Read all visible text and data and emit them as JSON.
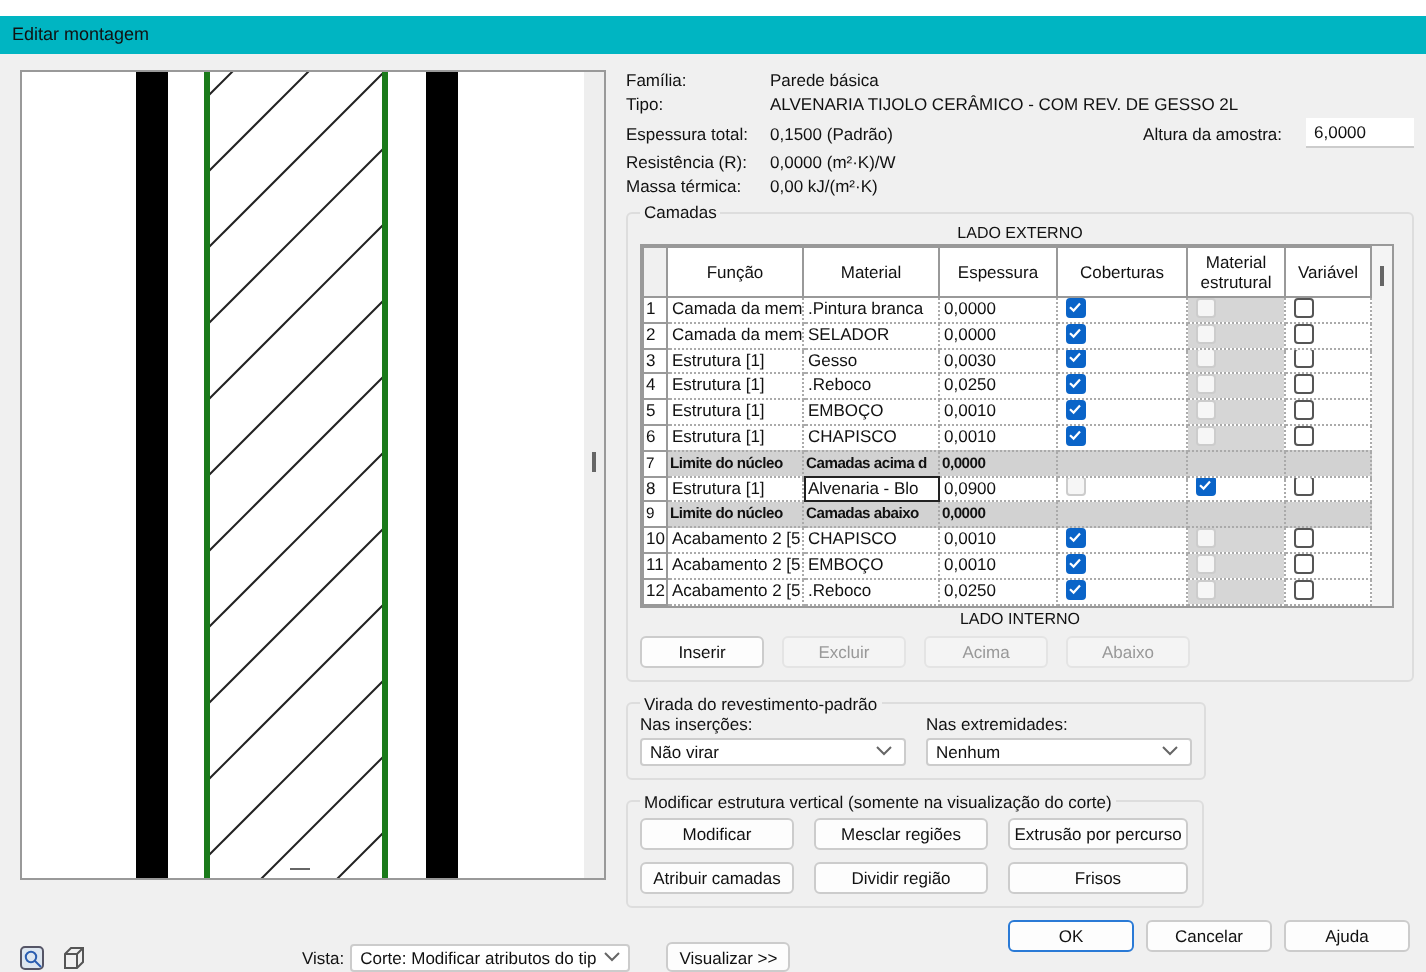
{
  "window": {
    "title": "Editar montagem"
  },
  "properties": [
    {
      "label": "Família:",
      "value": "Parede básica"
    },
    {
      "label": "Tipo:",
      "value": "ALVENARIA TIJOLO CERÂMICO - COM REV. DE GESSO 2L"
    },
    {
      "label": "Espessura total:",
      "value": "0,1500 (Padrão)"
    },
    {
      "label": "Resistência (R):",
      "value": "0,0000 (m²·K)/W"
    },
    {
      "label": "Massa térmica:",
      "value": "0,00 kJ/(m²·K)"
    }
  ],
  "sample_height": {
    "label": "Altura da amostra:",
    "value": "6,0000"
  },
  "layers": {
    "title": "Camadas",
    "top_label": "LADO EXTERNO",
    "bottom_label": "LADO INTERNO",
    "columns": [
      "Função",
      "Material",
      "Espessura",
      "Coberturas",
      "Material estrutural",
      "Variável"
    ],
    "rows": [
      {
        "index": "1",
        "kind": "layer",
        "function": "Camada da mem",
        "material": ".Pintura branca",
        "thickness": "0,0000",
        "focused": false,
        "coverings": {
          "checked": true,
          "disabled": false
        },
        "structural": {
          "checked": false,
          "disabled": true
        },
        "variable": {
          "checked": false
        }
      },
      {
        "index": "2",
        "kind": "layer",
        "function": "Camada da mem",
        "material": "SELADOR",
        "thickness": "0,0000",
        "focused": false,
        "coverings": {
          "checked": true,
          "disabled": false
        },
        "structural": {
          "checked": false,
          "disabled": true
        },
        "variable": {
          "checked": false
        }
      },
      {
        "index": "3",
        "kind": "layer",
        "function": "Estrutura [1]",
        "material": "Gesso",
        "thickness": "0,0030",
        "focused": false,
        "coverings": {
          "checked": true,
          "disabled": false
        },
        "structural": {
          "checked": false,
          "disabled": true
        },
        "variable": {
          "checked": false
        }
      },
      {
        "index": "4",
        "kind": "layer",
        "function": "Estrutura [1]",
        "material": ".Reboco",
        "thickness": "0,0250",
        "focused": false,
        "coverings": {
          "checked": true,
          "disabled": false
        },
        "structural": {
          "checked": false,
          "disabled": true
        },
        "variable": {
          "checked": false
        }
      },
      {
        "index": "5",
        "kind": "layer",
        "function": "Estrutura [1]",
        "material": "EMBOÇO",
        "thickness": "0,0010",
        "focused": false,
        "coverings": {
          "checked": true,
          "disabled": false
        },
        "structural": {
          "checked": false,
          "disabled": true
        },
        "variable": {
          "checked": false
        }
      },
      {
        "index": "6",
        "kind": "layer",
        "function": "Estrutura [1]",
        "material": "CHAPISCO",
        "thickness": "0,0010",
        "focused": false,
        "coverings": {
          "checked": true,
          "disabled": false
        },
        "structural": {
          "checked": false,
          "disabled": true
        },
        "variable": {
          "checked": false
        }
      },
      {
        "index": "7",
        "kind": "boundary",
        "function": "Limite do núcleo",
        "material": "Camadas acima d",
        "thickness": "0,0000"
      },
      {
        "index": "8",
        "kind": "layer",
        "function": "Estrutura [1]",
        "material": "Alvenaria - Blo",
        "thickness": "0,0900",
        "focused": true,
        "coverings": {
          "checked": false,
          "disabled": true
        },
        "structural": {
          "checked": true,
          "disabled": false
        },
        "variable": {
          "checked": false
        }
      },
      {
        "index": "9",
        "kind": "boundary",
        "function": "Limite do núcleo",
        "material": "Camadas abaixo",
        "thickness": "0,0000"
      },
      {
        "index": "10",
        "kind": "layer",
        "function": "Acabamento 2 [5",
        "material": "CHAPISCO",
        "thickness": "0,0010",
        "focused": false,
        "coverings": {
          "checked": true,
          "disabled": false
        },
        "structural": {
          "checked": false,
          "disabled": true
        },
        "variable": {
          "checked": false
        }
      },
      {
        "index": "11",
        "kind": "layer",
        "function": "Acabamento 2 [5",
        "material": "EMBOÇO",
        "thickness": "0,0010",
        "focused": false,
        "coverings": {
          "checked": true,
          "disabled": false
        },
        "structural": {
          "checked": false,
          "disabled": true
        },
        "variable": {
          "checked": false
        }
      },
      {
        "index": "12",
        "kind": "layer",
        "function": "Acabamento 2 [5",
        "material": ".Reboco",
        "thickness": "0,0250",
        "focused": false,
        "coverings": {
          "checked": true,
          "disabled": false
        },
        "structural": {
          "checked": false,
          "disabled": true
        },
        "variable": {
          "checked": false
        }
      }
    ],
    "buttons": [
      {
        "label": "Inserir",
        "disabled": false
      },
      {
        "label": "Excluir",
        "disabled": true
      },
      {
        "label": "Acima",
        "disabled": true
      },
      {
        "label": "Abaixo",
        "disabled": true
      }
    ]
  },
  "wrapping": {
    "title": "Virada do revestimento-padrão",
    "fields": [
      {
        "label": "Nas inserções:",
        "value": "Não virar"
      },
      {
        "label": "Nas extremidades:",
        "value": "Nenhum"
      }
    ]
  },
  "vertical": {
    "title": "Modificar estrutura vertical (somente na visualização do corte)",
    "buttons": [
      {
        "label": "Modificar"
      },
      {
        "label": "Mesclar regiões"
      },
      {
        "label": "Extrusão por percurso"
      },
      {
        "label": "Atribuir camadas"
      },
      {
        "label": "Dividir região"
      },
      {
        "label": "Frisos"
      }
    ]
  },
  "dialog_buttons": [
    {
      "label": "OK",
      "default": true
    },
    {
      "label": "Cancelar",
      "default": false
    },
    {
      "label": "Ajuda",
      "default": false
    }
  ],
  "view": {
    "label": "Vista:",
    "value": "Corte: Modificar atributos do tip"
  },
  "preview_button": "Visualizar >>"
}
